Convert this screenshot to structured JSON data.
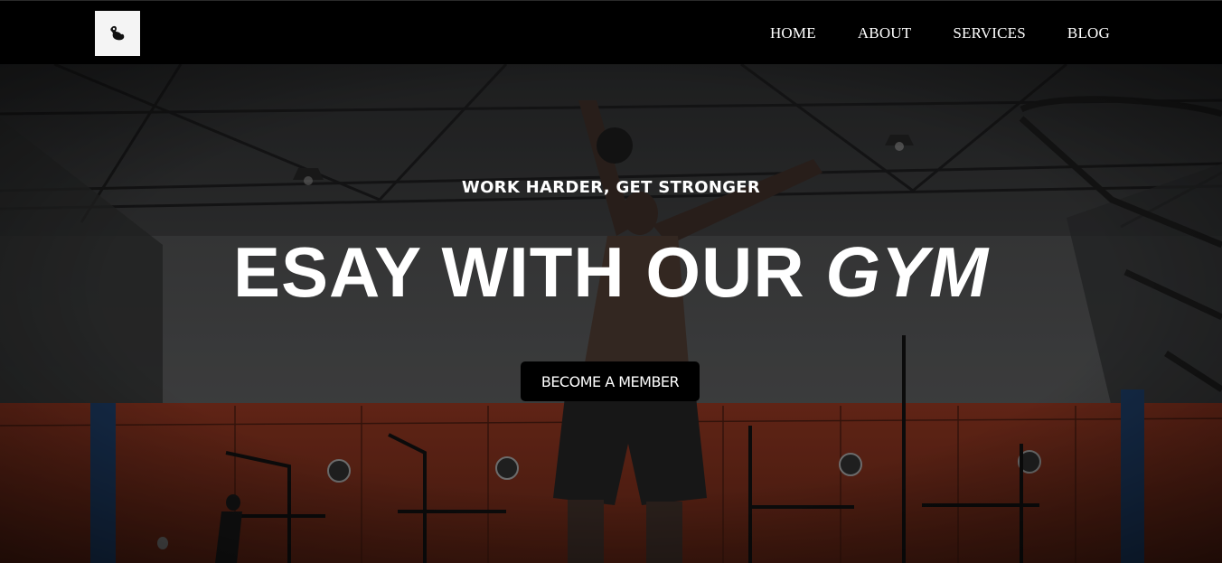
{
  "nav": {
    "logo": {
      "icon": "flexing-arm-icon"
    },
    "links": [
      {
        "label": "HOME"
      },
      {
        "label": "ABOUT"
      },
      {
        "label": "SERVICES"
      },
      {
        "label": "BLOG"
      }
    ]
  },
  "hero": {
    "tagline": "WORK HARDER, GET STRONGER",
    "headline_main": "ESAY WITH OUR ",
    "headline_emphasis": "GYM",
    "cta_label": "BECOME A MEMBER",
    "background": "gym-kettlebell-video-frame"
  },
  "colors": {
    "navbar_bg": "#000000",
    "text": "#ffffff",
    "cta_bg": "#000000",
    "wall_accent": "#b5432a"
  }
}
